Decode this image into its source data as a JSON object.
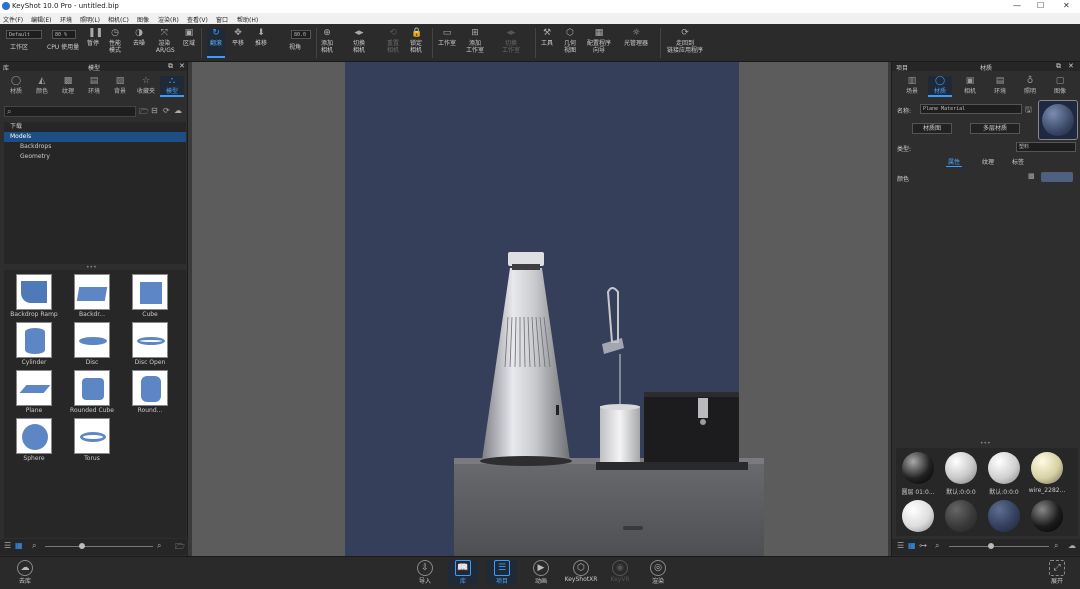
{
  "window": {
    "title": "KeyShot 10.0 Pro   - untitled.bip",
    "min": "—",
    "max": "☐",
    "close": "✕"
  },
  "menu": [
    "文件(F)",
    "编辑(E)",
    "环境",
    "照明(L)",
    "相机(C)",
    "图像",
    "渲染(R)",
    "查看(V)",
    "窗口",
    "帮助(H)"
  ],
  "toolbar": {
    "preset_value": "Default",
    "cpu_value": "80 %",
    "fov_value": "80.0",
    "items": [
      {
        "label": "工作区",
        "icon": "workspace-icon"
      },
      {
        "label": "CPU 使用量",
        "icon": "cpu-icon"
      },
      {
        "label": "暂停",
        "icon": "pause-icon"
      },
      {
        "label": "性能\n模式",
        "icon": "performance-icon"
      },
      {
        "label": "去噪",
        "icon": "denoise-icon"
      },
      {
        "label": "渲染\n AR/GS",
        "icon": "render-ar-icon"
      },
      {
        "label": "区域",
        "icon": "region-icon"
      },
      {
        "label": "翻滚",
        "icon": "tumble-icon"
      },
      {
        "label": "平移",
        "icon": "pan-icon"
      },
      {
        "label": "推移",
        "icon": "dolly-icon"
      },
      {
        "label": "视角",
        "icon": "fov-icon"
      },
      {
        "label": "添加\n相机",
        "icon": "add-camera-icon"
      },
      {
        "label": "切换\n相机",
        "icon": "switch-camera-icon"
      },
      {
        "label": "重置\n相机",
        "icon": "reset-camera-icon"
      },
      {
        "label": "锁定\n相机",
        "icon": "lock-camera-icon"
      },
      {
        "label": "工作室",
        "icon": "studio-icon"
      },
      {
        "label": "添加\n工作室",
        "icon": "add-studio-icon"
      },
      {
        "label": "切换\n工作室",
        "icon": "switch-studio-icon"
      },
      {
        "label": "工具",
        "icon": "tools-icon"
      },
      {
        "label": "几何\n视图",
        "icon": "geometry-view-icon"
      },
      {
        "label": "配置程序\n向导",
        "icon": "configurator-icon"
      },
      {
        "label": "光管理器",
        "icon": "light-manager-icon"
      },
      {
        "label": "走回到\n链接应用程序",
        "icon": "link-app-icon"
      }
    ]
  },
  "left_panel": {
    "header_left": "库",
    "header_center": "模型",
    "tabs": [
      {
        "label": "材质",
        "icon": "material-icon"
      },
      {
        "label": "颜色",
        "icon": "color-icon"
      },
      {
        "label": "纹理",
        "icon": "texture-icon"
      },
      {
        "label": "环境",
        "icon": "environment-icon"
      },
      {
        "label": "背景",
        "icon": "background-icon"
      },
      {
        "label": "收藏夹",
        "icon": "favorites-icon"
      },
      {
        "label": "模型",
        "icon": "model-icon"
      }
    ],
    "search_placeholder": "",
    "tree": [
      "下载",
      "Models",
      "Backdrops",
      "Geometry"
    ],
    "models": [
      "Backdrop Ramp",
      "Backdr...",
      "Cube",
      "Cylinder",
      "Disc",
      "Disc Open",
      "Plane",
      "Rounded Cube",
      "Round...",
      "Sphere",
      "Torus"
    ]
  },
  "right_panel": {
    "header_left": "项目",
    "header_center": "材质",
    "tabs": [
      {
        "label": "场景",
        "icon": "scene-icon"
      },
      {
        "label": "材质",
        "icon": "material-icon"
      },
      {
        "label": "相机",
        "icon": "camera-icon"
      },
      {
        "label": "环境",
        "icon": "environment-icon"
      },
      {
        "label": "照明",
        "icon": "lighting-icon"
      },
      {
        "label": "图像",
        "icon": "image-icon"
      }
    ],
    "name_label": "名称:",
    "name_value": "Plane Material",
    "material_graph_btn": "材质图",
    "multi_material_btn": "多层材质",
    "type_label": "类型:",
    "type_value": "塑料",
    "subtabs": [
      "属性",
      "纹理",
      "标签"
    ],
    "color_label": "颜色",
    "swatch_color": "#4e6080",
    "balls": [
      "圆层 01:0...",
      "默认:0:0:0",
      "默认:0:0:0",
      "wire_2282..."
    ]
  },
  "bottom": {
    "import": "导入",
    "library": "库",
    "project": "项目",
    "animation": "动画",
    "keyshotxr": "KeyShotXR",
    "keyvr": "KeyVR",
    "render": "渲染",
    "go_library": "去库",
    "expand": "展开"
  }
}
